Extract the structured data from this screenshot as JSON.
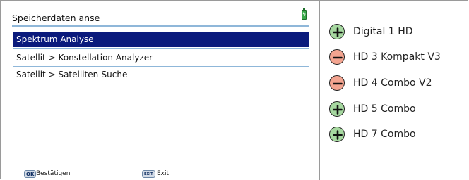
{
  "device": {
    "title": "Speicherdaten anse",
    "battery_icon": "battery-charging-icon",
    "menu": [
      {
        "label": "Spektrum Analyse",
        "selected": true
      },
      {
        "label": "Satellit > Konstellation Analyzer",
        "selected": false
      },
      {
        "label": "Satellit > Satelliten-Suche",
        "selected": false
      }
    ],
    "footer": {
      "ok_key": "OK",
      "ok_label": "Bestätigen",
      "exit_key": "EXIT",
      "exit_label": "Exit"
    },
    "selection_color": "#0a1a7c"
  },
  "compatibility": [
    {
      "model": "Digital 1 HD",
      "supported": true,
      "icon": "plus-circle-icon"
    },
    {
      "model": "HD 3 Kompakt V3",
      "supported": false,
      "icon": "minus-circle-icon"
    },
    {
      "model": "HD 4 Combo V2",
      "supported": false,
      "icon": "minus-circle-icon"
    },
    {
      "model": "HD 5 Combo",
      "supported": true,
      "icon": "plus-circle-icon"
    },
    {
      "model": "HD 7 Combo",
      "supported": true,
      "icon": "plus-circle-icon"
    }
  ],
  "colors": {
    "supported": "#a6d8a0",
    "unsupported": "#f3a490"
  }
}
